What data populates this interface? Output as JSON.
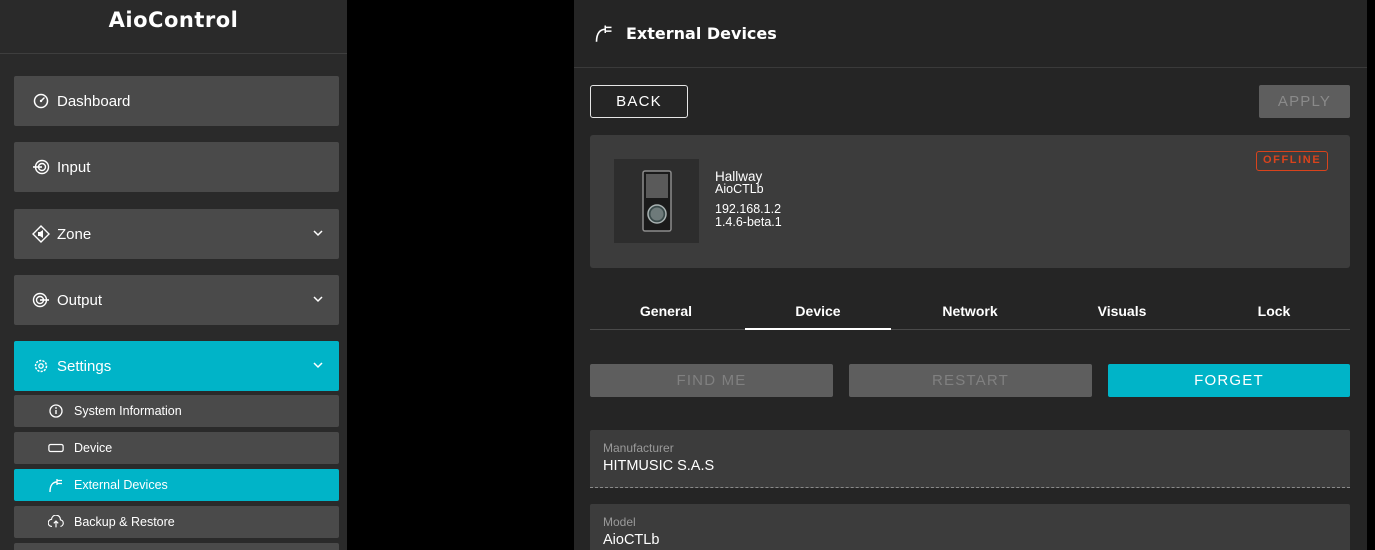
{
  "app": {
    "name": "AioControl"
  },
  "sidebar": {
    "items": [
      {
        "label": "Dashboard",
        "icon": "dashboard-icon"
      },
      {
        "label": "Input",
        "icon": "input-icon"
      },
      {
        "label": "Zone",
        "icon": "zone-icon",
        "expandable": true
      },
      {
        "label": "Output",
        "icon": "output-icon",
        "expandable": true
      },
      {
        "label": "Settings",
        "icon": "settings-icon",
        "expandable": true,
        "active": true
      }
    ],
    "subitems": [
      {
        "label": "System Information",
        "icon": "info-icon"
      },
      {
        "label": "Device",
        "icon": "device-icon"
      },
      {
        "label": "External Devices",
        "icon": "external-devices-icon",
        "active": true
      },
      {
        "label": "Backup & Restore",
        "icon": "backup-icon"
      }
    ]
  },
  "header": {
    "title": "External Devices",
    "icon": "external-devices-icon"
  },
  "toolbar": {
    "back_label": "BACK",
    "apply_label": "APPLY"
  },
  "device": {
    "name": "Hallway",
    "model": "AioCTLb",
    "ip": "192.168.1.2",
    "firmware": "1.4.6-beta.1",
    "status": "OFFLINE"
  },
  "tabs": [
    {
      "label": "General"
    },
    {
      "label": "Device",
      "active": true
    },
    {
      "label": "Network"
    },
    {
      "label": "Visuals"
    },
    {
      "label": "Lock"
    }
  ],
  "actions": {
    "find_me": "FIND ME",
    "restart": "RESTART",
    "forget": "FORGET"
  },
  "fields": [
    {
      "label": "Manufacturer",
      "value": "HITMUSIC S.A.S"
    },
    {
      "label": "Model",
      "value": "AioCTLb"
    }
  ],
  "colors": {
    "accent": "#00b4c8",
    "offline": "#d9431c",
    "sidebar_item": "#4a4a4a",
    "panel": "#252525"
  }
}
